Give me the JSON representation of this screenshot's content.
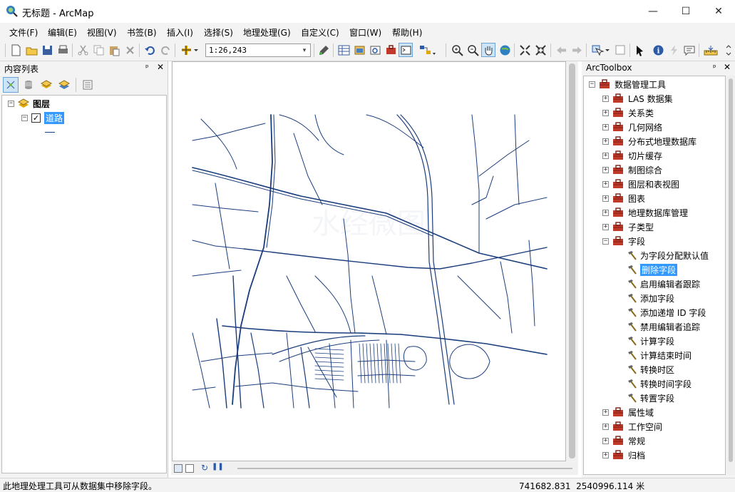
{
  "window": {
    "title": "无标题 - ArcMap",
    "controls": {
      "minimize": "—",
      "maximize": "☐",
      "close": "✕"
    }
  },
  "menu": [
    "文件(F)",
    "编辑(E)",
    "视图(V)",
    "书签(B)",
    "插入(I)",
    "选择(S)",
    "地理处理(G)",
    "自定义(C)",
    "窗口(W)",
    "帮助(H)"
  ],
  "toolbar": {
    "scale": "1:26,243",
    "icons": [
      "new-document-icon",
      "open-folder-icon",
      "save-icon",
      "print-icon",
      "cut-icon",
      "copy-icon",
      "paste-icon",
      "delete-icon",
      "undo-icon",
      "redo-icon",
      "add-data-icon",
      "scale-dropdown",
      "editor-icon",
      "table-icon",
      "catalog-icon",
      "search-window-icon",
      "toolbox-icon",
      "python-icon",
      "model-builder-icon",
      "zoom-in-icon",
      "zoom-out-icon",
      "pan-icon",
      "full-extent-icon",
      "fixed-zoom-in-icon",
      "fixed-zoom-out-icon",
      "back-extent-icon",
      "forward-extent-icon",
      "select-features-icon",
      "clear-selection-icon",
      "select-elements-icon",
      "identify-icon",
      "html-popup-icon",
      "find-icon",
      "measure-icon"
    ]
  },
  "toc": {
    "title": "内容列表",
    "root_label": "图层",
    "layer_label": "道路",
    "layer_checked": true
  },
  "arctoolbox": {
    "title": "ArcToolbox",
    "root": "数据管理工具",
    "items": [
      {
        "label": "LAS 数据集",
        "expander": "+"
      },
      {
        "label": "关系类",
        "expander": "+"
      },
      {
        "label": "几何网络",
        "expander": "+"
      },
      {
        "label": "分布式地理数据库",
        "expander": "+"
      },
      {
        "label": "切片缓存",
        "expander": "+"
      },
      {
        "label": "制图综合",
        "expander": "+"
      },
      {
        "label": "图层和表视图",
        "expander": "+"
      },
      {
        "label": "图表",
        "expander": "+"
      },
      {
        "label": "地理数据库管理",
        "expander": "+"
      },
      {
        "label": "子类型",
        "expander": "+"
      },
      {
        "label": "字段",
        "expander": "−"
      }
    ],
    "field_tools": [
      "为字段分配默认值",
      "删除字段",
      "启用编辑者跟踪",
      "添加字段",
      "添加递增 ID 字段",
      "禁用编辑者追踪",
      "计算字段",
      "计算结束时间",
      "转换时区",
      "转换时间字段",
      "转置字段"
    ],
    "selected_tool": "删除字段",
    "after_items": [
      {
        "label": "属性域",
        "expander": "+"
      },
      {
        "label": "工作空间",
        "expander": "+"
      },
      {
        "label": "常规",
        "expander": "+"
      },
      {
        "label": "归档",
        "expander": "+"
      }
    ]
  },
  "status": {
    "message": "此地理处理工具可从数据集中移除字段。",
    "coords": "741682.831  2540996.114 米"
  },
  "map": {
    "road_color": "#1a3d7c",
    "watermark": "水经微图"
  }
}
